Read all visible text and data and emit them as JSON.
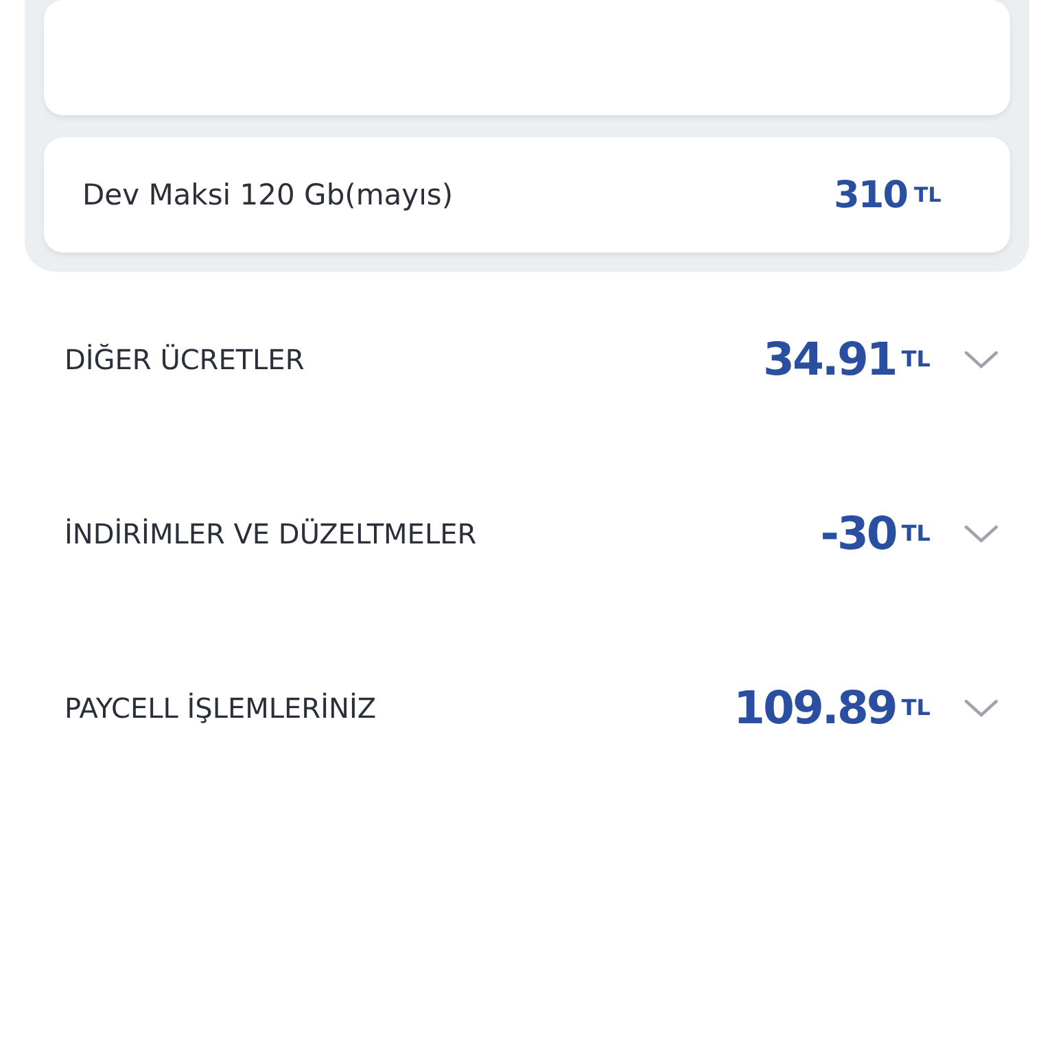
{
  "items": [
    {
      "name": "Dev Maksi 120 Gb(mayıs)",
      "amount": "310",
      "currency": "TL"
    }
  ],
  "sections": [
    {
      "title": "DİĞER ÜCRETLER",
      "amount": "34.91",
      "currency": "TL",
      "expanded": false
    },
    {
      "title": "İNDİRİMLER VE DÜZELTMELER",
      "amount": "-30",
      "currency": "TL",
      "expanded": false
    },
    {
      "title": "PAYCELL İŞLEMLERİNİZ",
      "amount": "109.89",
      "currency": "TL",
      "expanded": false
    }
  ]
}
